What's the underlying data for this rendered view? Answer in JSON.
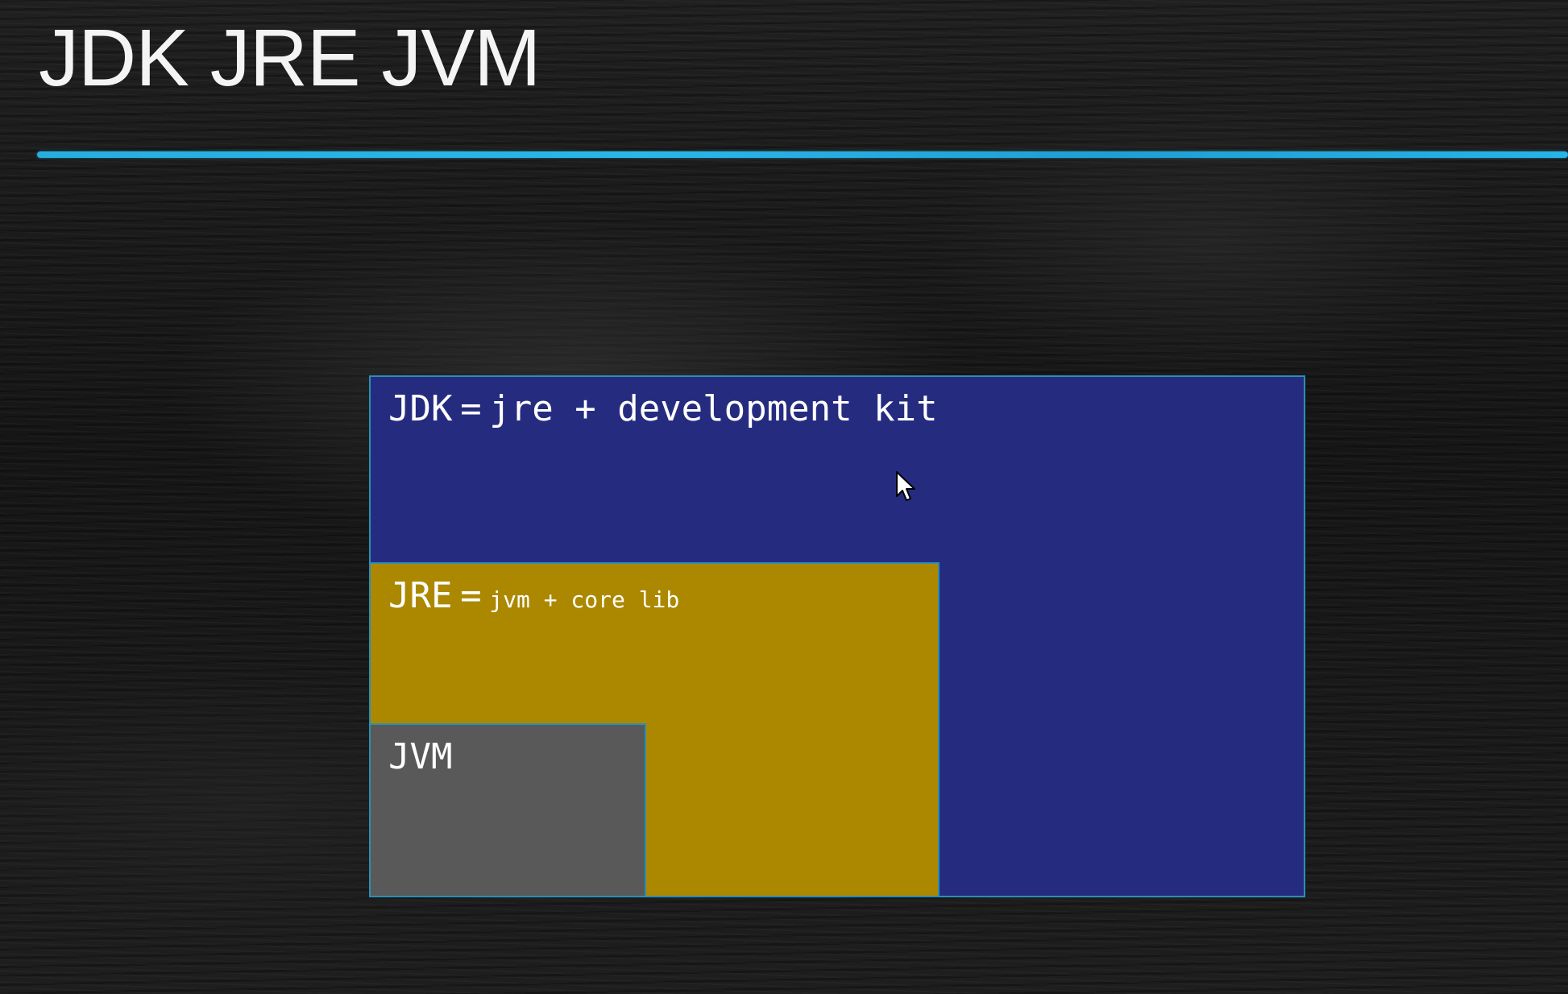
{
  "slide": {
    "title": "JDK JRE JVM"
  },
  "diagram": {
    "jdk": {
      "name": "JDK",
      "equals": "=",
      "definition": "jre + development kit",
      "color": "#252c80"
    },
    "jre": {
      "name": "JRE",
      "equals": "=",
      "definition": "jvm + core lib",
      "color": "#ac8800"
    },
    "jvm": {
      "name": "JVM",
      "color": "#595959"
    }
  },
  "colors": {
    "underline": "#27aee0",
    "box_border": "#2a8fb5",
    "background": "#1a1a1a"
  },
  "icons": {
    "pointer": "mouse-pointer-icon"
  }
}
